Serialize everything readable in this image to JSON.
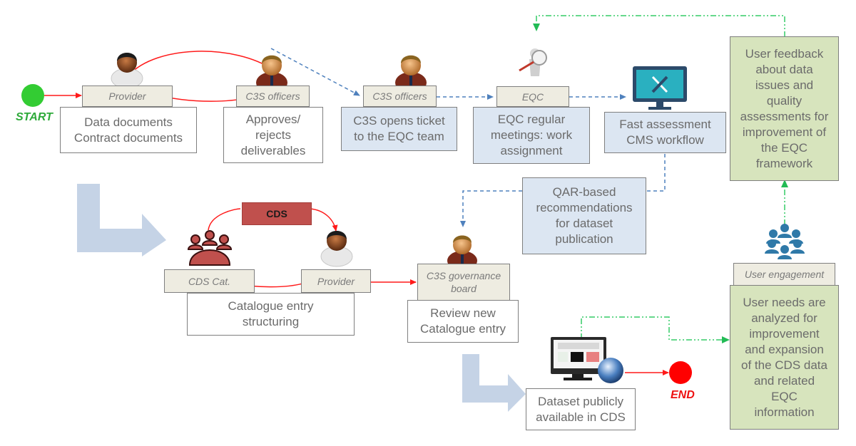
{
  "terminals": {
    "start": {
      "label": "START",
      "color": "#33cc33"
    },
    "end": {
      "label": "END",
      "color": "#ff0000"
    }
  },
  "colors": {
    "flow_red": "#ff1a1a",
    "flow_blue": "#4f81bd",
    "flow_green": "#33cc66",
    "box_blue": "#dce6f2",
    "box_green": "#d7e4bd",
    "label_bg": "#eeece1",
    "big_arrow": "#c5d3e6",
    "cds_red": "#c0504d"
  },
  "nodes": {
    "provider1": {
      "role": "Provider",
      "text": "Data documents\nContract documents",
      "icon": "person-provider-icon"
    },
    "officers1": {
      "role": "C3S officers",
      "text": "Approves/\nrejects\ndeliverables",
      "icon": "person-officer-icon"
    },
    "officers2": {
      "role": "C3S officers",
      "text": "C3S opens ticket\nto the EQC team",
      "icon": "person-officer-icon"
    },
    "eqc": {
      "role": "EQC",
      "text": "EQC regular\nmeetings: work\nassignment",
      "icon": "magnifier-figure-icon"
    },
    "fast": {
      "text": "Fast assessment\nCMS workflow",
      "icon": "monitor-tools-icon"
    },
    "feedback": {
      "text": "User feedback\nabout data\nissues and\nquality\nassessments for\nimprovement of\nthe EQC\nframework"
    },
    "qar": {
      "text": "QAR-based\nrecommendations\nfor dataset\npublication"
    },
    "cds_tag": {
      "text": "CDS"
    },
    "cds_cat": {
      "role": "CDS Cat.",
      "icon": "meeting-group-icon"
    },
    "provider2": {
      "role": "Provider",
      "icon": "person-provider-icon"
    },
    "catalogue": {
      "text": "Catalogue entry\nstructuring"
    },
    "governance": {
      "role": "C3S governance\nboard",
      "text": "Review new\nCatalogue entry",
      "icon": "person-officer-icon"
    },
    "user_engagement": {
      "role": "User engagement",
      "text": "User needs are\nanalyzed for\nimprovement\nand expansion\nof the CDS data\nand related\nEQC\ninformation",
      "icon": "user-group-icon"
    },
    "dataset": {
      "text": "Dataset publicly\navailable in CDS",
      "icon": "monitor-globe-icon"
    }
  }
}
